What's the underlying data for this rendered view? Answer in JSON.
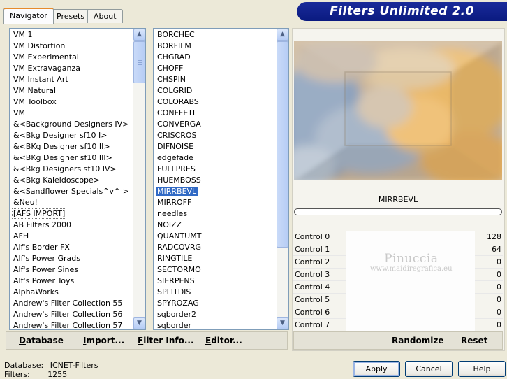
{
  "tabs": [
    {
      "label": "Navigator"
    },
    {
      "label": "Presets"
    },
    {
      "label": "About"
    }
  ],
  "banner": "Filters Unlimited 2.0",
  "categories": [
    "VM 1",
    "VM Distortion",
    "VM Experimental",
    "VM Extravaganza",
    "VM Instant Art",
    "VM Natural",
    "VM Toolbox",
    "VM",
    "&<Background Designers IV>",
    "&<Bkg Designer sf10 I>",
    "&<BKg Designer sf10 II>",
    "&<BKg Designer sf10 III>",
    "&<Bkg Designers sf10 IV>",
    "&<Bkg Kaleidoscope>",
    "&<Sandflower Specials^v^ >",
    "&Neu!",
    "[AFS IMPORT]",
    "AB Filters 2000",
    "AFH",
    "Alf's Border FX",
    "Alf's Power Grads",
    "Alf's Power Sines",
    "Alf's Power Toys",
    "AlphaWorks",
    "Andrew's Filter Collection 55",
    "Andrew's Filter Collection 56",
    "Andrew's Filter Collection 57"
  ],
  "filters": [
    "BORCHEC",
    "BORFILM",
    "CHGRAD",
    "CHOFF",
    "CHSPIN",
    "COLGRID",
    "COLORABS",
    "CONFFETI",
    "CONVERGA",
    "CRISCROS",
    "DIFNOISE",
    "edgefade",
    "FULLPRES",
    "HUEMBOSS",
    "MIRRBEVL",
    "MIRROFF",
    "needles",
    "NOIZZ",
    "QUANTUMT",
    "RADCOVRG",
    "RINGTILE",
    "SECTORMO",
    "SIERPENS",
    "SPLITDIS",
    "SPYROZAG",
    "sqborder2",
    "sqborder"
  ],
  "selected_category": "[AFS IMPORT]",
  "selected_filter": "MIRRBEVL",
  "left_buttons": {
    "database": "Database",
    "import": "Import...",
    "filter_info": "Filter Info...",
    "editor": "Editor..."
  },
  "right_buttons": {
    "randomize": "Randomize",
    "reset": "Reset"
  },
  "filter_name": "MIRRBEVL",
  "controls": [
    {
      "label": "Control 0",
      "value": "128"
    },
    {
      "label": "Control 1",
      "value": "64"
    },
    {
      "label": "Control 2",
      "value": "0"
    },
    {
      "label": "Control 3",
      "value": "0"
    },
    {
      "label": "Control 4",
      "value": "0"
    },
    {
      "label": "Control 5",
      "value": "0"
    },
    {
      "label": "Control 6",
      "value": "0"
    },
    {
      "label": "Control 7",
      "value": "0"
    }
  ],
  "watermark": {
    "name": "Pinuccia",
    "url": "www.maidiregrafica.eu"
  },
  "status": {
    "database_label": "Database:",
    "database_value": "ICNET-Filters",
    "filters_label": "Filters:",
    "filters_value": "1255"
  },
  "dialog_buttons": {
    "apply": "Apply",
    "cancel": "Cancel",
    "help": "Help"
  },
  "colors": {
    "banner": "#0a1a80",
    "selection": "#316ac5",
    "window_bg": "#ece9d8"
  }
}
